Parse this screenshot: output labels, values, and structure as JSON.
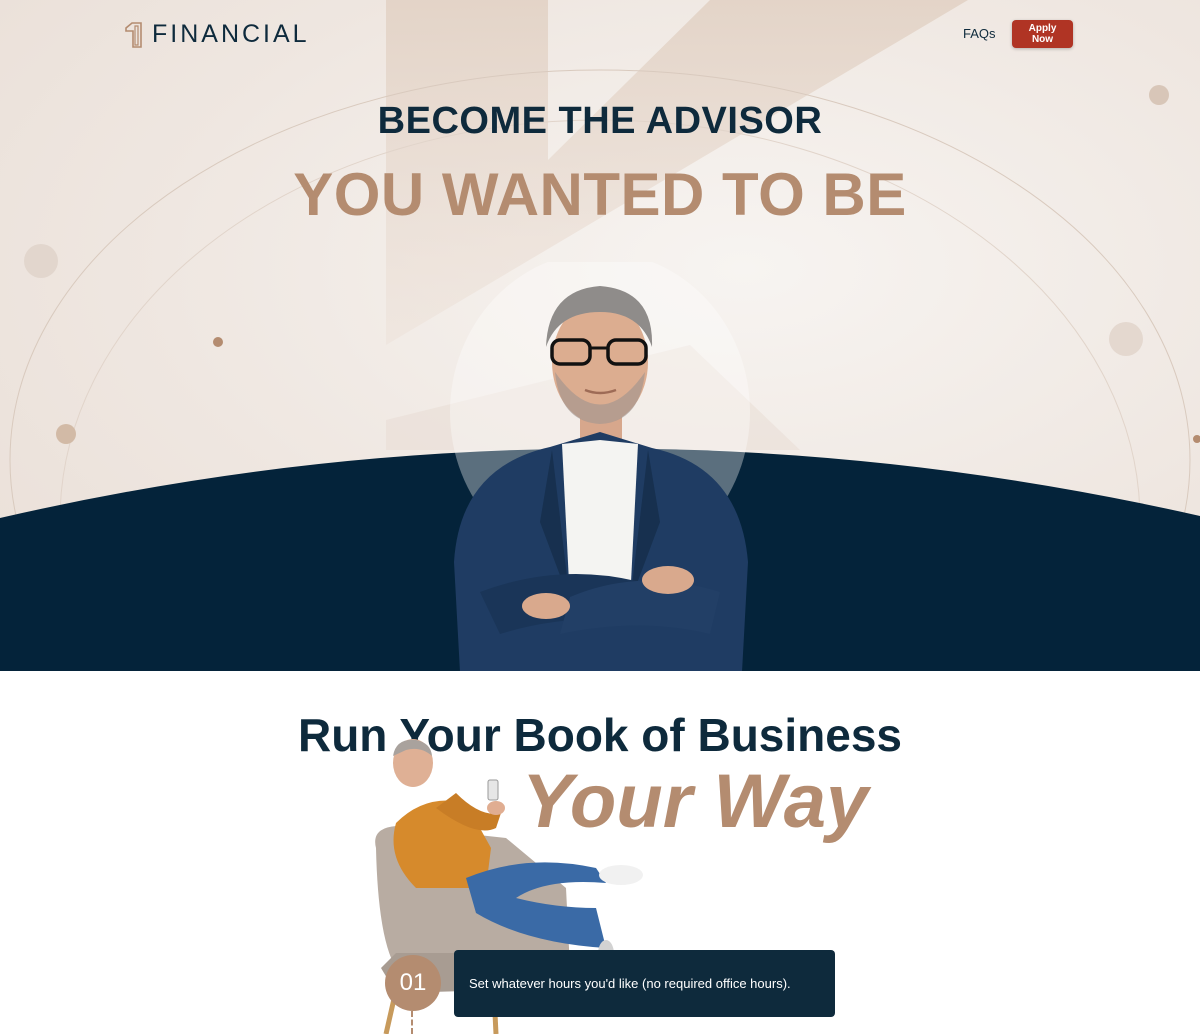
{
  "brand": {
    "logo_text": "FINANCIAL",
    "logo_icon": "number-one-logo-icon"
  },
  "nav": {
    "faqs_label": "FAQs",
    "apply_label": "Apply Now"
  },
  "hero": {
    "line1": "BECOME THE ADVISOR",
    "line2": "YOU WANTED TO BE"
  },
  "section2": {
    "line1": "Run Your Book of Business",
    "line2": "Your Way",
    "steps": [
      {
        "number": "01",
        "text": "Set whatever hours you'd like (no required office hours)."
      }
    ]
  },
  "colors": {
    "navy": "#0e2a3c",
    "tan": "#b48c70",
    "cta_red": "#b03424",
    "hero_bg": "#efe7e1"
  }
}
